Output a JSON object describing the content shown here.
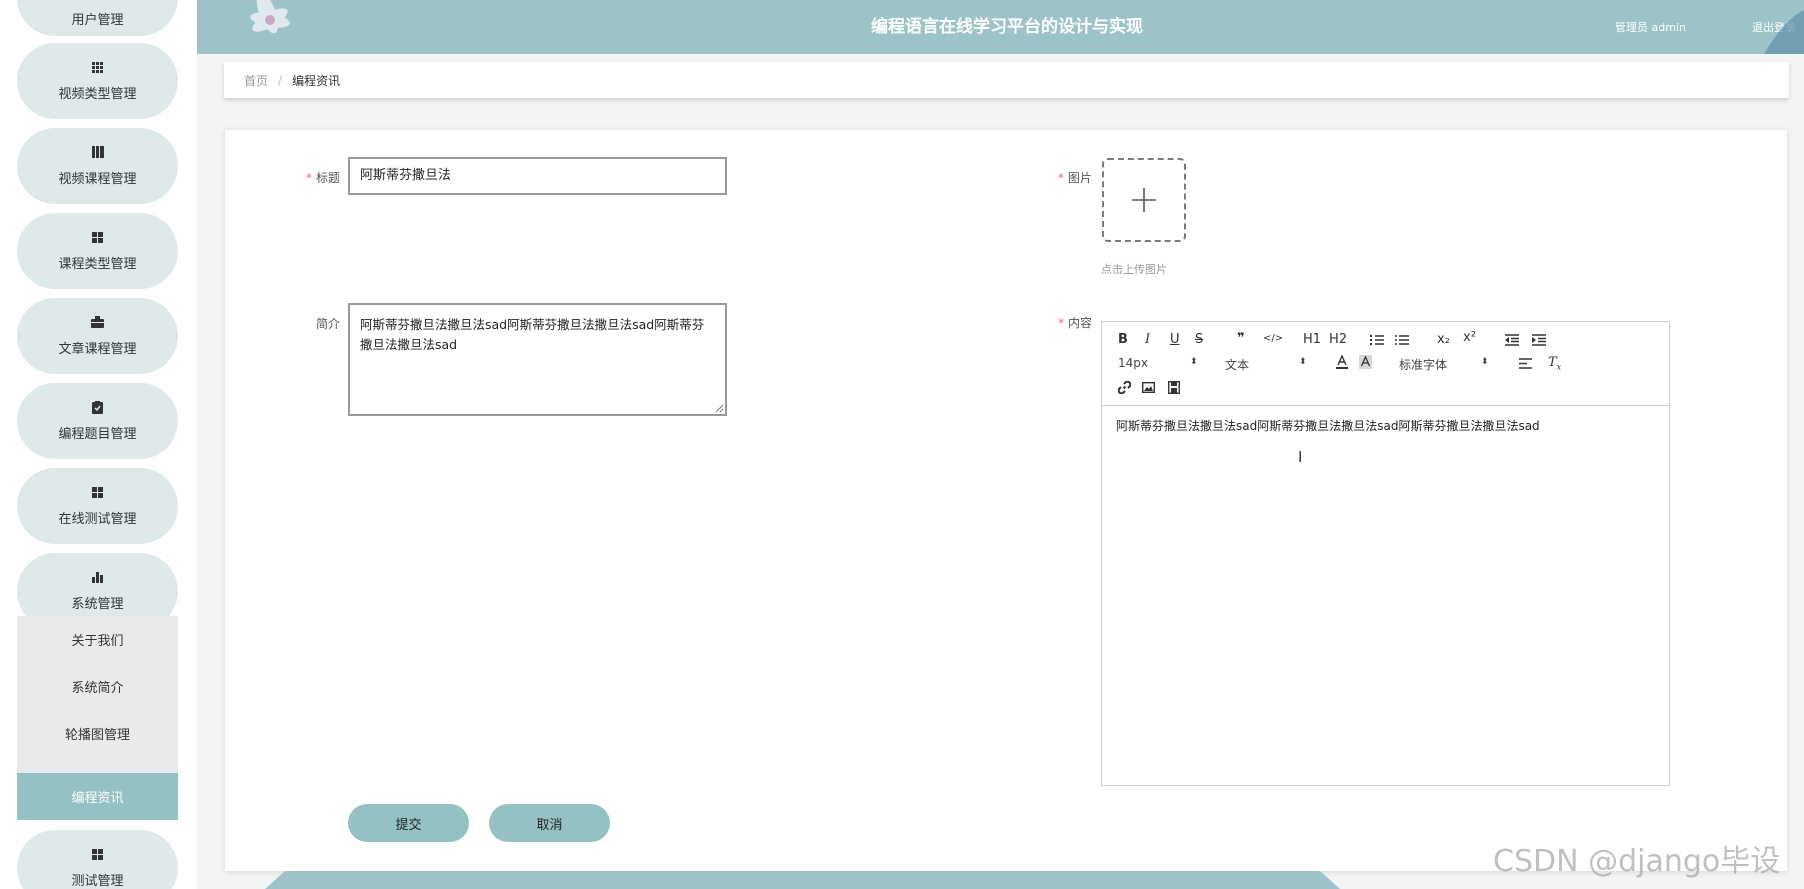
{
  "header": {
    "title": "编程语言在线学习平台的设计与实现",
    "user": "管理员 admin",
    "logout": "退出登录"
  },
  "sidebar": {
    "items": [
      {
        "label": "用户管理",
        "icon": "user-icon"
      },
      {
        "label": "视频类型管理",
        "icon": "grid-icon"
      },
      {
        "label": "视频课程管理",
        "icon": "book-icon"
      },
      {
        "label": "课程类型管理",
        "icon": "grid-icon"
      },
      {
        "label": "文章课程管理",
        "icon": "briefcase-icon"
      },
      {
        "label": "编程题目管理",
        "icon": "clipboard-icon"
      },
      {
        "label": "在线测试管理",
        "icon": "grid-icon"
      },
      {
        "label": "系统管理",
        "icon": "bar-chart-icon"
      },
      {
        "label": "测试管理",
        "icon": "grid-icon"
      }
    ],
    "submenu": [
      "关于我们",
      "系统简介",
      "轮播图管理",
      "编程资讯"
    ],
    "active_sub": "编程资讯"
  },
  "breadcrumb": {
    "home": "首页",
    "separator": "/",
    "current": "编程资讯"
  },
  "form": {
    "title_label": "标题",
    "title_value": "阿斯蒂芬撒旦法",
    "intro_label": "简介",
    "intro_value": "阿斯蒂芬撒旦法撒旦法sad阿斯蒂芬撒旦法撒旦法sad阿斯蒂芬撒旦法撒旦法sad",
    "image_label": "图片",
    "upload_tip": "点击上传图片",
    "content_label": "内容",
    "required_mark": "*"
  },
  "editor": {
    "toolbar": {
      "bold": "B",
      "italic": "I",
      "underline": "U",
      "strike": "S",
      "blockquote": "❞",
      "code": "</>",
      "h1": "H1",
      "h2": "H2",
      "subscript": "x₂",
      "superscript": "x²",
      "size": "14px",
      "header_select": "文本",
      "font_select": "标准字体"
    },
    "content": "阿斯蒂芬撒旦法撒旦法sad阿斯蒂芬撒旦法撒旦法sad阿斯蒂芬撒旦法撒旦法sad"
  },
  "buttons": {
    "submit": "提交",
    "cancel": "取消"
  },
  "watermark": "CSDN @django毕设",
  "colors": {
    "accent": "#94c1c4",
    "header": "#9cc4c8",
    "pill": "#dfe9ea",
    "required": "#f56c6c"
  }
}
